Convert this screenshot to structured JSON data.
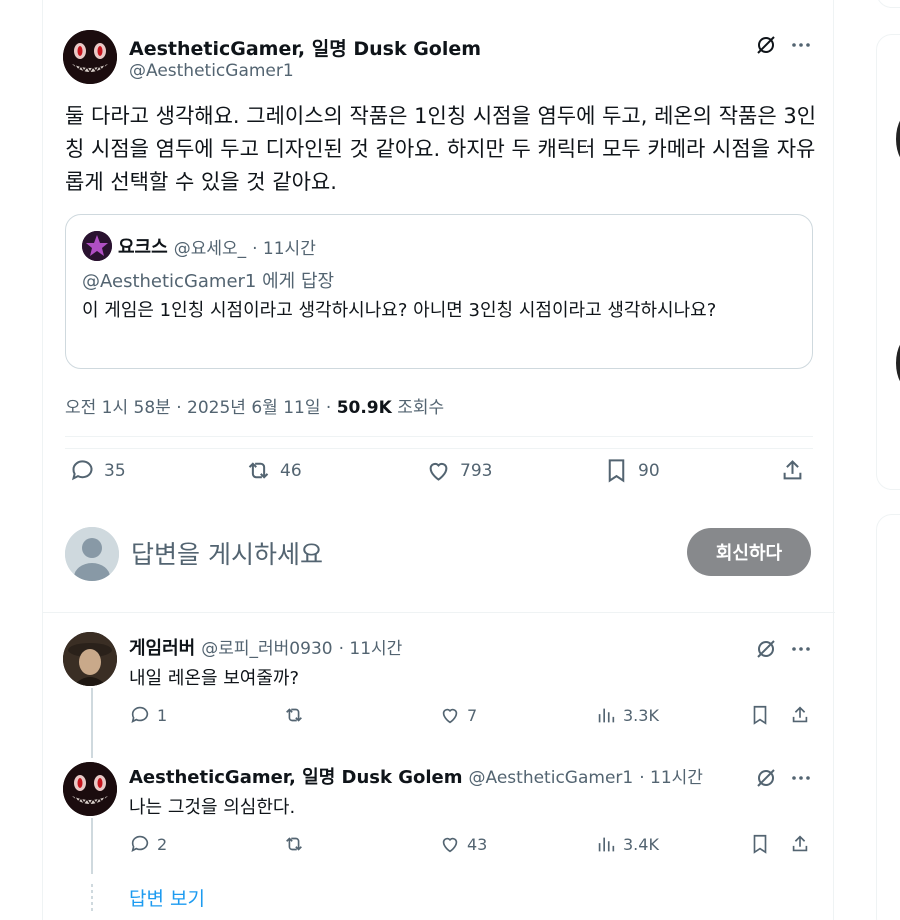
{
  "tweet": {
    "author_name": "AestheticGamer, 일명 Dusk Golem",
    "author_handle": "@AestheticGamer1",
    "text": "둘 다라고 생각해요. 그레이스의 작품은 1인칭 시점을 염두에 두고, 레온의 작품은 3인칭 시점을 염두에 두고 디자인된 것 같아요. 하지만 두 캐릭터 모두 카메라 시점을 자유롭게 선택할 수 있을 것 같아요.",
    "quote": {
      "author_name": "요크스",
      "author_handle": "@요세오_",
      "time": "· 11시간",
      "reply_to": "@AestheticGamer1 에게 답장",
      "text": "이 게임은 1인칭 시점이라고 생각하시나요? 아니면 3인칭 시점이라고 생각하시나요?"
    },
    "meta_time": "오전 1시 58분 · 2025년 6월 11일 · ",
    "views_count": "50.9K",
    "views_label": " 조회수",
    "stats": {
      "replies": "35",
      "reposts": "46",
      "likes": "793",
      "bookmarks": "90"
    }
  },
  "composer": {
    "placeholder": "답변을 게시하세요",
    "reply_button": "회신하다"
  },
  "replies": [
    {
      "author_name": "게임러버",
      "author_handle": "@로피_러버0930",
      "time": "· 11시간",
      "text": "내일 레온을 보여줄까?",
      "replies": "1",
      "reposts": "",
      "likes": "7",
      "views": "3.3K"
    },
    {
      "author_name": "AestheticGamer, 일명 Dusk Golem",
      "author_handle": "@AestheticGamer1",
      "time": "· 11시간",
      "text": "나는 그것을 의심한다.",
      "replies": "2",
      "reposts": "",
      "likes": "43",
      "views": "3.4K"
    }
  ],
  "show_replies": "답변 보기",
  "colors": {
    "accent": "#1d9bf0",
    "muted": "#536471",
    "border": "#eff3f4",
    "button_disabled": "#87898c"
  }
}
